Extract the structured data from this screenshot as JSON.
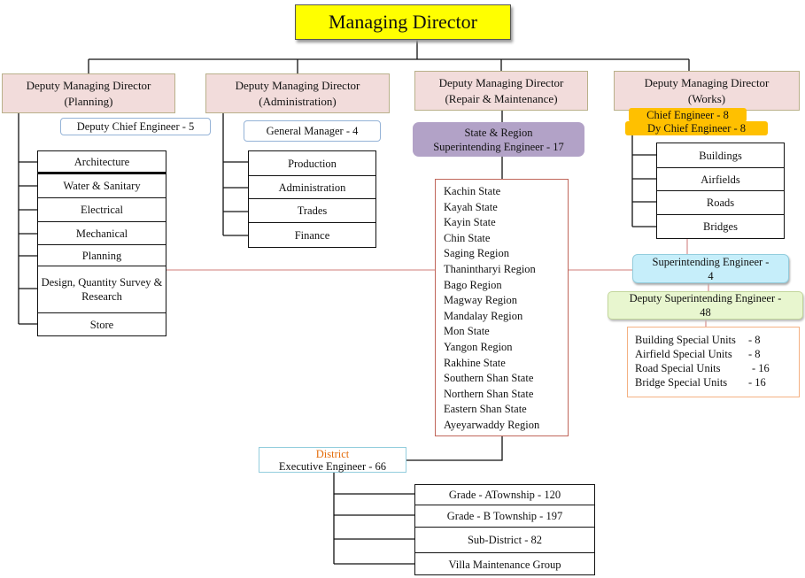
{
  "managing_director": "Managing Director",
  "planning": {
    "title": "Deputy Managing Director",
    "subtitle": "(Planning)",
    "head": "Deputy Chief Engineer  - 5",
    "items": [
      "Architecture",
      "Water & Sanitary",
      "Electrical",
      "Mechanical",
      "Planning",
      "Design, Quantity Survey & Research",
      "Store"
    ]
  },
  "administration": {
    "title": "Deputy Managing Director",
    "subtitle": "(Administration)",
    "head": "General Manager  - 4",
    "items": [
      "Production",
      "Administration",
      "Trades",
      "Finance"
    ]
  },
  "repair": {
    "title": "Deputy Managing Director",
    "subtitle": "(Repair & Maintenance)",
    "head_line1": "State & Region",
    "head_line2": "Superintending  Engineer  - 17",
    "states": [
      "Kachin State",
      "Kayah State",
      "Kayin State",
      "Chin  State",
      "Saging  Region",
      "Thanintharyi  Region",
      "Bago Region",
      "Magway  Region",
      "Mandalay Region",
      "Mon State",
      "Yangon Region",
      "Rakhine State",
      "Southern  Shan State",
      "Northern  Shan State",
      "Eastern Shan State",
      "Ayeyarwaddy Region"
    ],
    "district_label": "District",
    "district": "Executive Engineer  - 66",
    "district_items": [
      "Grade  - ATownship - 120",
      "Grade - B Township - 197",
      "Sub-District - 82",
      "Villa Maintenance  Group"
    ]
  },
  "works": {
    "title": "Deputy Managing Director",
    "subtitle": "(Works)",
    "chief": "Chief Engineer  - 8",
    "dy_chief": "Dy Chief  Engineer  - 8",
    "items": [
      "Buildings",
      "Airfields",
      "Roads",
      "Bridges"
    ],
    "se_line1": "Superintending  Engineer  -",
    "se_line2": "4",
    "dse_line1": "Deputy Superintending   Engineer  -",
    "dse_line2": "48",
    "units": [
      {
        "name": "Building Special Units",
        "count": "- 8"
      },
      {
        "name": "Airfield Special Units",
        "count": "- 8"
      },
      {
        "name": "Road Special Units",
        "count": "- 16"
      },
      {
        "name": "Bridge Special Units",
        "count": "- 16"
      }
    ]
  },
  "colors": {
    "md": "#ffff00",
    "dmd": "#f2dcdb",
    "state_region": "#b2a2c7",
    "chief": "#ffc000",
    "se": "#c6eefa",
    "dse": "#e8f6cf",
    "district_label": "#e46c0a"
  }
}
